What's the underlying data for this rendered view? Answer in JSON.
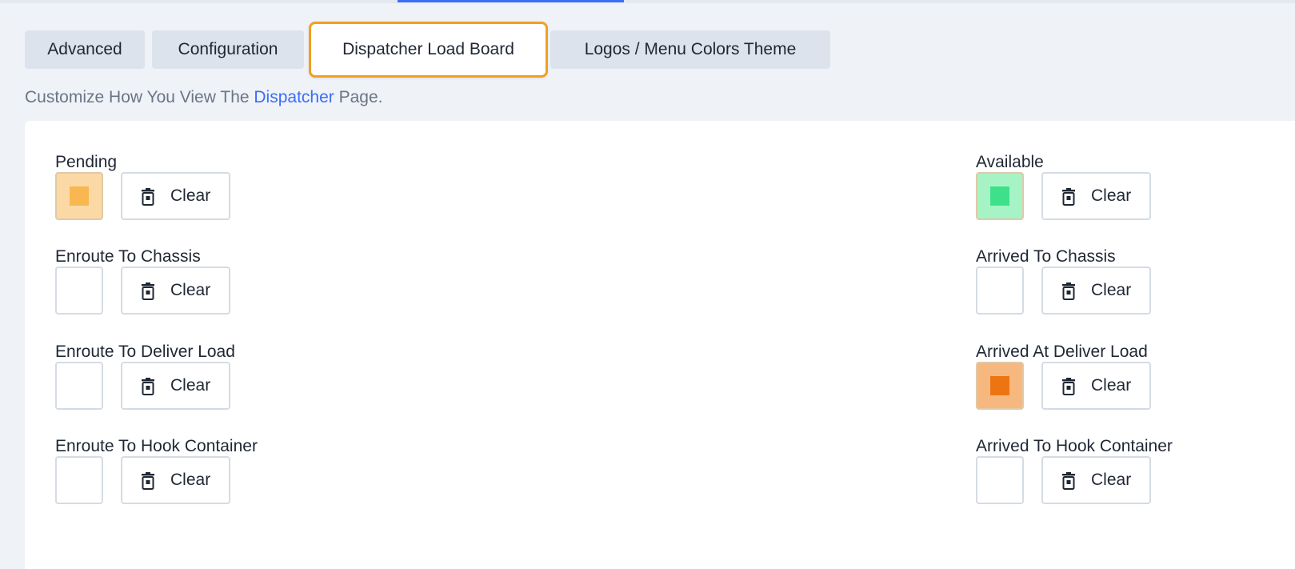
{
  "tabs": [
    {
      "label": "Advanced"
    },
    {
      "label": "Configuration"
    },
    {
      "label": "Dispatcher Load Board"
    },
    {
      "label": "Logos / Menu Colors Theme"
    }
  ],
  "subtitle": {
    "before": "Customize How You View The ",
    "link": "Dispatcher",
    "after": " Page."
  },
  "colors": {
    "accent": "#3b6ef5",
    "active_tab_border": "#f0a020"
  },
  "clear_label": "Clear",
  "trash_icon": "trash-icon",
  "statuses": {
    "left": [
      {
        "label": "Pending",
        "fill": "#fbd9a5",
        "inner": "#f9b751"
      },
      {
        "label": "Enroute To Chassis",
        "fill": "#ffffff",
        "inner": ""
      },
      {
        "label": "Enroute To Deliver Load",
        "fill": "#ffffff",
        "inner": ""
      },
      {
        "label": "Enroute To Hook Container",
        "fill": "#ffffff",
        "inner": ""
      }
    ],
    "right": [
      {
        "label": "Available",
        "fill": "#a6f4c5",
        "inner": "#3ee08a"
      },
      {
        "label": "Arrived To Chassis",
        "fill": "#ffffff",
        "inner": ""
      },
      {
        "label": "Arrived At Deliver Load",
        "fill": "#f7b87f",
        "inner": "#ec7512"
      },
      {
        "label": "Arrived To Hook Container",
        "fill": "#ffffff",
        "inner": ""
      }
    ]
  }
}
